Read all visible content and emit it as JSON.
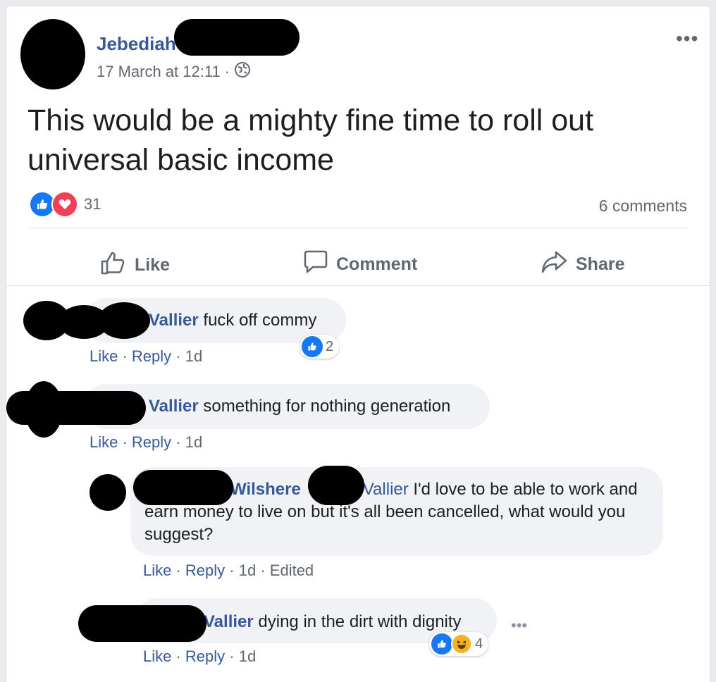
{
  "post": {
    "author_first": "Jebediah",
    "date": "17 March at 12:11",
    "sep": "·",
    "text": "This would be a mighty fine time to roll out universal basic income",
    "reaction_count": "31",
    "comments_count": "6 comments",
    "more": "•••"
  },
  "actions": {
    "like": "Like",
    "comment": "Comment",
    "share": "Share"
  },
  "comments": [
    {
      "name": "Vallier",
      "text": " fuck off commy",
      "like": "Like",
      "reply": "Reply",
      "time": "1d",
      "reactions": "2"
    },
    {
      "name": "Vallier",
      "text": " something for nothing generation",
      "like": "Like",
      "reply": "Reply",
      "time": "1d"
    }
  ],
  "replies": [
    {
      "name": "Wilshere",
      "mention": "Vallier",
      "text": " I'd love to be able to work and earn money to live on but it's all been cancelled, what would you suggest?",
      "like": "Like",
      "reply": "Reply",
      "time": "1d",
      "edited": "Edited"
    },
    {
      "name": "Vallier",
      "text": " dying in the dirt with dignity",
      "like": "Like",
      "reply": "Reply",
      "time": "1d",
      "reactions": "4",
      "more": "•••"
    }
  ],
  "colors": {
    "link": "#385898",
    "like_blue": "#1877f2",
    "love_red": "#f33e58",
    "haha_yellow": "#f7b125"
  }
}
